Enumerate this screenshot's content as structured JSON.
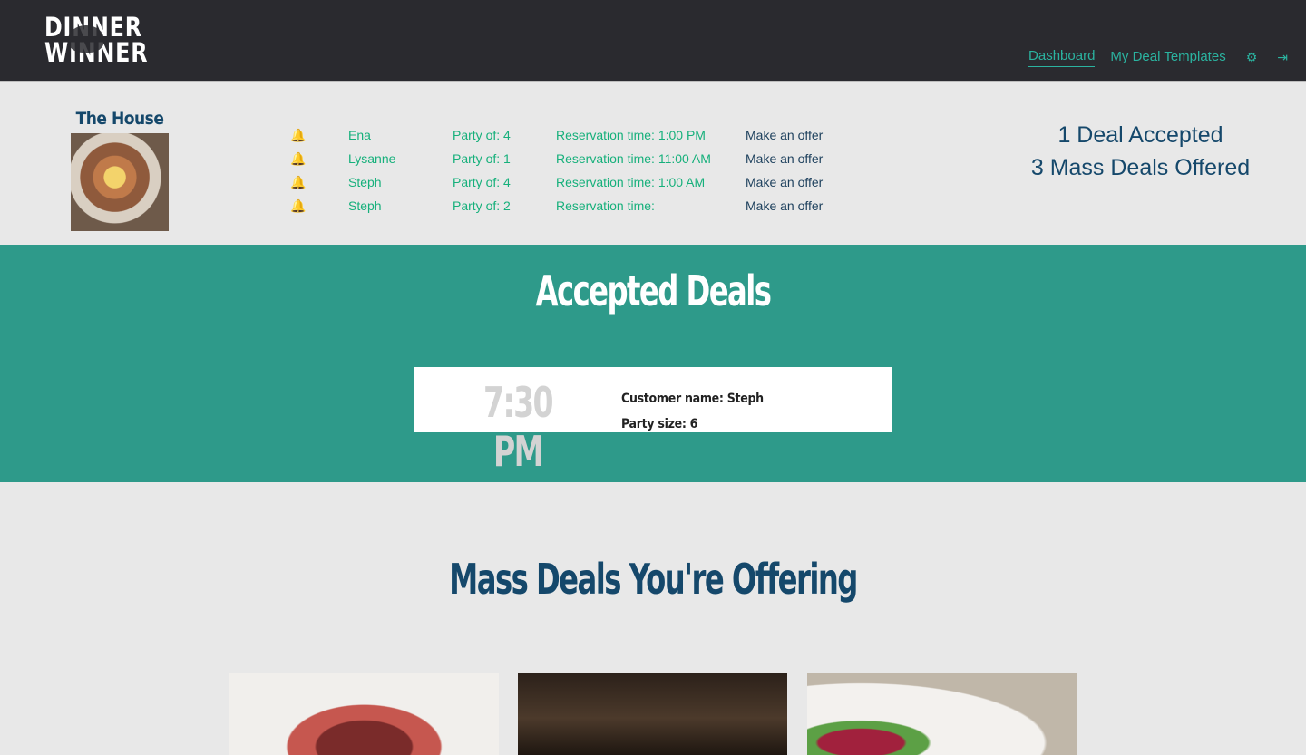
{
  "header": {
    "logo_text": "DINNER WINNER",
    "nav": {
      "dashboard": "Dashboard",
      "templates": "My Deal Templates"
    },
    "icons": {
      "settings": "gear-icon",
      "logout": "sign-out-icon"
    },
    "accent_color": "#2bb3a0"
  },
  "restaurant": {
    "name": "The House"
  },
  "requests": [
    {
      "name": "Ena",
      "party": "Party of: 4",
      "time": "Reservation time: 1:00 PM",
      "action": "Make an offer"
    },
    {
      "name": "Lysanne",
      "party": "Party of: 1",
      "time": "Reservation time: 11:00 AM",
      "action": "Make an offer"
    },
    {
      "name": "Steph",
      "party": "Party of: 4",
      "time": "Reservation time: 1:00 AM",
      "action": "Make an offer"
    },
    {
      "name": "Steph",
      "party": "Party of: 2",
      "time": "Reservation time:",
      "action": "Make an offer"
    }
  ],
  "stats": {
    "accepted": "1 Deal Accepted",
    "offered": "3 Mass Deals Offered"
  },
  "accepted_section": {
    "title": "Accepted Deals",
    "deals": [
      {
        "time": "7:30 PM",
        "customer": "Customer name: Steph",
        "party": "Party size: 6"
      }
    ],
    "bg_color": "#2e9a8a"
  },
  "mass_section": {
    "title": "Mass Deals You're Offering"
  },
  "colors": {
    "navy": "#15486b",
    "green": "#16b07b",
    "dark_bg": "#2a2a2f"
  }
}
